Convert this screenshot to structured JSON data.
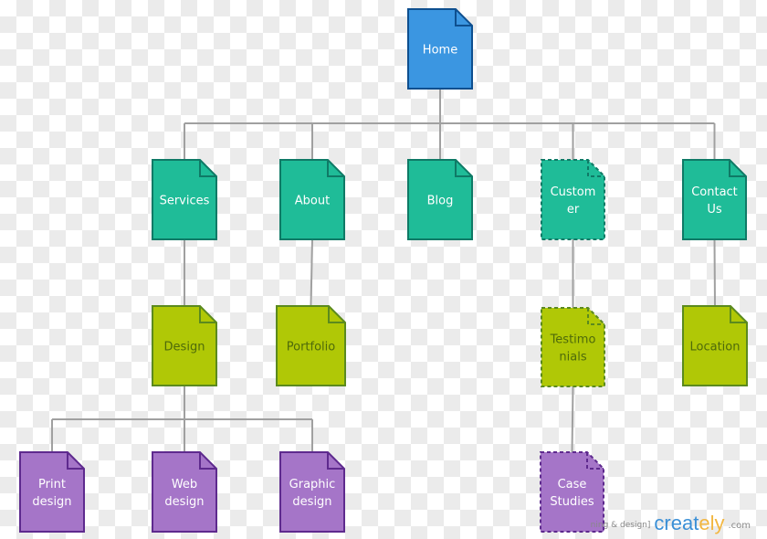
{
  "diagram": {
    "type": "sitemap",
    "colors": {
      "root_fill": "#3b96e1",
      "root_stroke": "#0e4f8f",
      "root_text": "#ffffff",
      "level1_fill": "#1fbc98",
      "level1_stroke": "#0f7a66",
      "level1_text": "#ffffff",
      "level2_fill": "#b0c806",
      "level2_stroke": "#5b8a1e",
      "level2_text": "#4e6a0a",
      "level3_fill": "#a575c8",
      "level3_stroke": "#5e2a8e",
      "level3_text": "#ffffff",
      "connector": "#a0a0a0"
    },
    "nodes": [
      {
        "id": "home",
        "lines": [
          "Home"
        ],
        "level": "root",
        "dashed": false
      },
      {
        "id": "services",
        "lines": [
          "Services"
        ],
        "level": "level1",
        "dashed": false,
        "parent": "home"
      },
      {
        "id": "about",
        "lines": [
          "About"
        ],
        "level": "level1",
        "dashed": false,
        "parent": "home"
      },
      {
        "id": "blog",
        "lines": [
          "Blog"
        ],
        "level": "level1",
        "dashed": false,
        "parent": "home"
      },
      {
        "id": "customer",
        "lines": [
          "Custom",
          "er"
        ],
        "level": "level1",
        "dashed": true,
        "parent": "home"
      },
      {
        "id": "contact-us",
        "lines": [
          "Contact",
          "Us"
        ],
        "level": "level1",
        "dashed": false,
        "parent": "home"
      },
      {
        "id": "design",
        "lines": [
          "Design"
        ],
        "level": "level2",
        "dashed": false,
        "parent": "services"
      },
      {
        "id": "portfolio",
        "lines": [
          "Portfolio"
        ],
        "level": "level2",
        "dashed": false,
        "parent": "about"
      },
      {
        "id": "testimonials",
        "lines": [
          "Testimo",
          "nials"
        ],
        "level": "level2",
        "dashed": true,
        "parent": "customer"
      },
      {
        "id": "location",
        "lines": [
          "Location"
        ],
        "level": "level2",
        "dashed": false,
        "parent": "contact-us"
      },
      {
        "id": "print-design",
        "lines": [
          "Print",
          "design"
        ],
        "level": "level3",
        "dashed": false,
        "parent": "design"
      },
      {
        "id": "web-design",
        "lines": [
          "Web",
          "design"
        ],
        "level": "level3",
        "dashed": false,
        "parent": "design"
      },
      {
        "id": "graphic-design",
        "lines": [
          "Graphic",
          "design"
        ],
        "level": "level3",
        "dashed": false,
        "parent": "design"
      },
      {
        "id": "case-studies",
        "lines": [
          "Case",
          "Studies"
        ],
        "level": "level3",
        "dashed": true,
        "parent": "testimonials"
      }
    ]
  },
  "watermark": {
    "note": "ning & design]",
    "brand_main": "creat",
    "brand_accent": "ely",
    "brand_suffix": ".com"
  }
}
